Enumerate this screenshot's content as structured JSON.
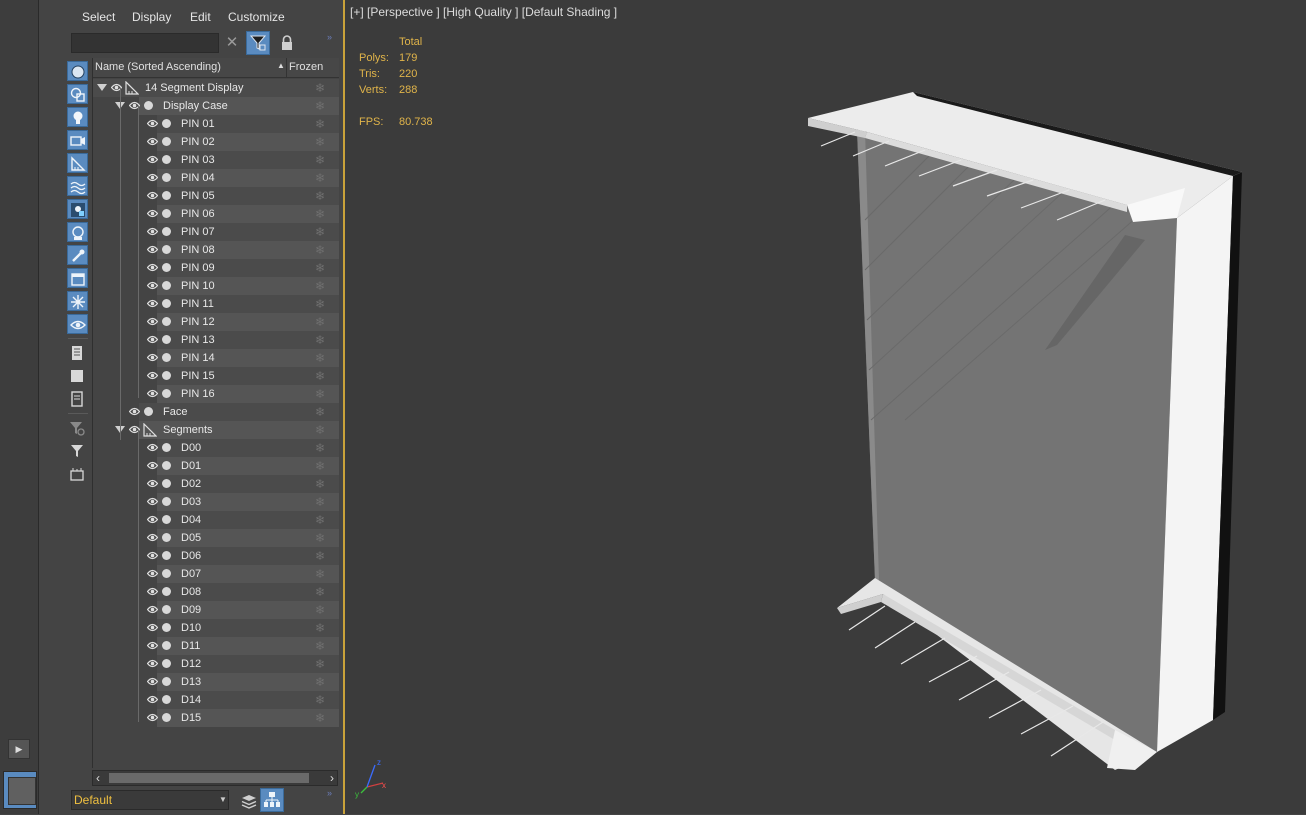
{
  "menu": [
    "Select",
    "Display",
    "Edit",
    "Customize"
  ],
  "search": {
    "value": "",
    "placeholder": ""
  },
  "header": {
    "name_col": "Name (Sorted Ascending)",
    "frozen_col": "Frozen",
    "sort": "ascending"
  },
  "tree": [
    {
      "name": "14 Segment Display",
      "depth": 0,
      "kind": "group",
      "expanded": true
    },
    {
      "name": "Display Case",
      "depth": 1,
      "kind": "object",
      "expanded": true
    },
    {
      "name": "PIN 01",
      "depth": 2,
      "kind": "object"
    },
    {
      "name": "PIN 02",
      "depth": 2,
      "kind": "object"
    },
    {
      "name": "PIN 03",
      "depth": 2,
      "kind": "object"
    },
    {
      "name": "PIN 04",
      "depth": 2,
      "kind": "object"
    },
    {
      "name": "PIN 05",
      "depth": 2,
      "kind": "object"
    },
    {
      "name": "PIN 06",
      "depth": 2,
      "kind": "object"
    },
    {
      "name": "PIN 07",
      "depth": 2,
      "kind": "object"
    },
    {
      "name": "PIN 08",
      "depth": 2,
      "kind": "object"
    },
    {
      "name": "PIN 09",
      "depth": 2,
      "kind": "object"
    },
    {
      "name": "PIN 10",
      "depth": 2,
      "kind": "object"
    },
    {
      "name": "PIN 11",
      "depth": 2,
      "kind": "object"
    },
    {
      "name": "PIN 12",
      "depth": 2,
      "kind": "object"
    },
    {
      "name": "PIN 13",
      "depth": 2,
      "kind": "object"
    },
    {
      "name": "PIN 14",
      "depth": 2,
      "kind": "object"
    },
    {
      "name": "PIN 15",
      "depth": 2,
      "kind": "object"
    },
    {
      "name": "PIN 16",
      "depth": 2,
      "kind": "object"
    },
    {
      "name": "Face",
      "depth": 1,
      "kind": "object"
    },
    {
      "name": "Segments",
      "depth": 1,
      "kind": "group",
      "expanded": true
    },
    {
      "name": "D00",
      "depth": 2,
      "kind": "object"
    },
    {
      "name": "D01",
      "depth": 2,
      "kind": "object"
    },
    {
      "name": "D02",
      "depth": 2,
      "kind": "object"
    },
    {
      "name": "D03",
      "depth": 2,
      "kind": "object"
    },
    {
      "name": "D04",
      "depth": 2,
      "kind": "object"
    },
    {
      "name": "D05",
      "depth": 2,
      "kind": "object"
    },
    {
      "name": "D06",
      "depth": 2,
      "kind": "object"
    },
    {
      "name": "D07",
      "depth": 2,
      "kind": "object"
    },
    {
      "name": "D08",
      "depth": 2,
      "kind": "object"
    },
    {
      "name": "D09",
      "depth": 2,
      "kind": "object"
    },
    {
      "name": "D10",
      "depth": 2,
      "kind": "object"
    },
    {
      "name": "D11",
      "depth": 2,
      "kind": "object"
    },
    {
      "name": "D12",
      "depth": 2,
      "kind": "object"
    },
    {
      "name": "D13",
      "depth": 2,
      "kind": "object"
    },
    {
      "name": "D14",
      "depth": 2,
      "kind": "object"
    },
    {
      "name": "D15",
      "depth": 2,
      "kind": "object"
    }
  ],
  "layer": {
    "current": "Default"
  },
  "viewport": {
    "label": "[+] [Perspective ] [High Quality ] [Default Shading ]",
    "stats": {
      "header": "Total",
      "polys_label": "Polys:",
      "polys": "179",
      "tris_label": "Tris:",
      "tris": "220",
      "verts_label": "Verts:",
      "verts": "288",
      "fps_label": "FPS:",
      "fps": "80.738"
    },
    "axes": {
      "x": "x",
      "y": "y",
      "z": "z"
    }
  },
  "colors": {
    "accent": "#5a8bc0",
    "viewport_border": "#c9a23a",
    "stats_text": "#e0b44a",
    "layer_text": "#f0c040"
  },
  "icons": {
    "tools": [
      "sphere-icon",
      "shapes-icon",
      "light-icon",
      "camera-icon",
      "helper-icon",
      "spacewarp-icon",
      "group-icon",
      "xref-icon",
      "bone-icon",
      "container-icon",
      "frozen-icon",
      "hidden-icon",
      "select-all-icon",
      "select-none-icon",
      "invert-selection-icon",
      "filter-settings-icon",
      "filter-icon",
      "layer-toggle-icon"
    ]
  }
}
